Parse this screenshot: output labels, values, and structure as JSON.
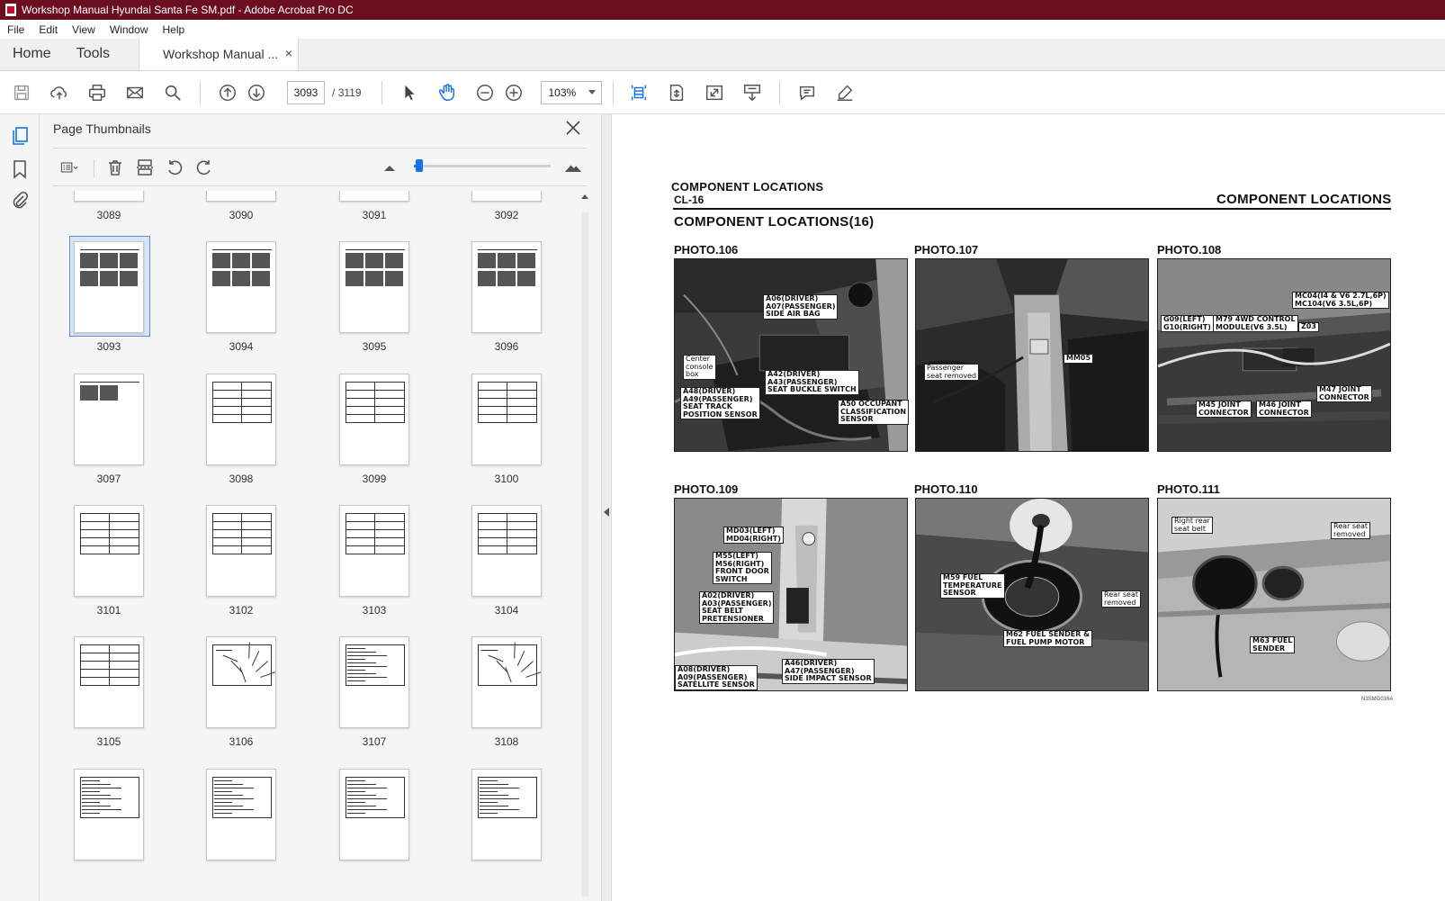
{
  "window": {
    "title": "Workshop Manual Hyundai Santa Fe SM.pdf - Adobe Acrobat Pro DC"
  },
  "menu": {
    "items": [
      "File",
      "Edit",
      "View",
      "Window",
      "Help"
    ]
  },
  "tabs": {
    "home": "Home",
    "tools": "Tools",
    "document": "Workshop Manual ...",
    "close_symbol": "×"
  },
  "toolbar": {
    "current_page": "3093",
    "page_separator": "/",
    "total_pages": "3119",
    "zoom": "103%",
    "icons": [
      "save-icon",
      "upload-icon",
      "print-icon",
      "email-icon",
      "search-icon",
      "prev-page-icon",
      "next-page-icon",
      "select-cursor-icon",
      "hand-icon",
      "zoom-out-icon",
      "zoom-in-icon",
      "fit-page-icon",
      "rotate-view-icon",
      "fullscreen-icon",
      "scroll-mode-icon",
      "comment-icon",
      "highlight-pen-icon"
    ],
    "accent_color": "#1473e6"
  },
  "sidebar": {
    "icons": [
      "page-thumbnails-icon",
      "bookmark-icon",
      "attachment-icon"
    ]
  },
  "thumbnails_panel": {
    "title": "Page Thumbnails",
    "close_symbol": "✕",
    "slider_value_fraction": 0.04,
    "rows": [
      [
        "3089",
        "3090",
        "3091",
        "3092"
      ],
      [
        "3093",
        "3094",
        "3095",
        "3096"
      ],
      [
        "3097",
        "3098",
        "3099",
        "3100"
      ],
      [
        "3101",
        "3102",
        "3103",
        "3104"
      ],
      [
        "3105",
        "3106",
        "3107",
        "3108"
      ],
      [
        "",
        "",
        "",
        ""
      ]
    ],
    "selected_page": "3093"
  },
  "document": {
    "header_left": "COMPONENT LOCATIONS",
    "header_code": "CL-16",
    "header_right": "COMPONENT LOCATIONS",
    "section_title": "COMPONENT LOCATIONS(16)",
    "footer_code": "N3SMG016A",
    "photos": [
      {
        "title": "PHOTO.106",
        "callouts": [
          "A06(DRIVER)\nA07(PASSENGER)\nSIDE AIR BAG",
          "Center\nconsole\nbox",
          "A42(DRIVER)\nA43(PASSENGER)\nSEAT BUCKLE SWITCH",
          "A48(DRIVER)\nA49(PASSENGER)\nSEAT TRACK\nPOSITION SENSOR",
          "A50 OCCUPANT\nCLASSIFICATION\nSENSOR"
        ]
      },
      {
        "title": "PHOTO.107",
        "callouts": [
          "MM05",
          "Passenger\nseat removed"
        ]
      },
      {
        "title": "PHOTO.108",
        "callouts": [
          "MC04(I4 & V6 2.7L,6P)\nMC104(V6 3.5L,6P)",
          "G09(LEFT)\nG10(RIGHT)",
          "M79 4WD CONTROL\nMODULE(V6 3.5L)",
          "Z03",
          "M47 JOINT\nCONNECTOR",
          "M45 JOINT\nCONNECTOR",
          "M46 JOINT\nCONNECTOR"
        ]
      },
      {
        "title": "PHOTO.109",
        "callouts": [
          "MD03(LEFT)\nMD04(RIGHT)",
          "M55(LEFT)\nM56(RIGHT)\nFRONT DOOR\nSWITCH",
          "A02(DRIVER)\nA03(PASSENGER)\nSEAT BELT\nPRETENSIONER",
          "A08(DRIVER)\nA09(PASSENGER)\nSATELLITE SENSOR",
          "A46(DRIVER)\nA47(PASSENGER)\nSIDE IMPACT SENSOR"
        ]
      },
      {
        "title": "PHOTO.110",
        "callouts": [
          "M59 FUEL\nTEMPERATURE\nSENSOR",
          "Rear seat\nremoved",
          "M62 FUEL SENDER &\nFUEL PUMP MOTOR"
        ]
      },
      {
        "title": "PHOTO.111",
        "callouts": [
          "Right rear\nseat belt",
          "Rear seat\nremoved",
          "M63 FUEL\nSENDER"
        ]
      }
    ]
  }
}
